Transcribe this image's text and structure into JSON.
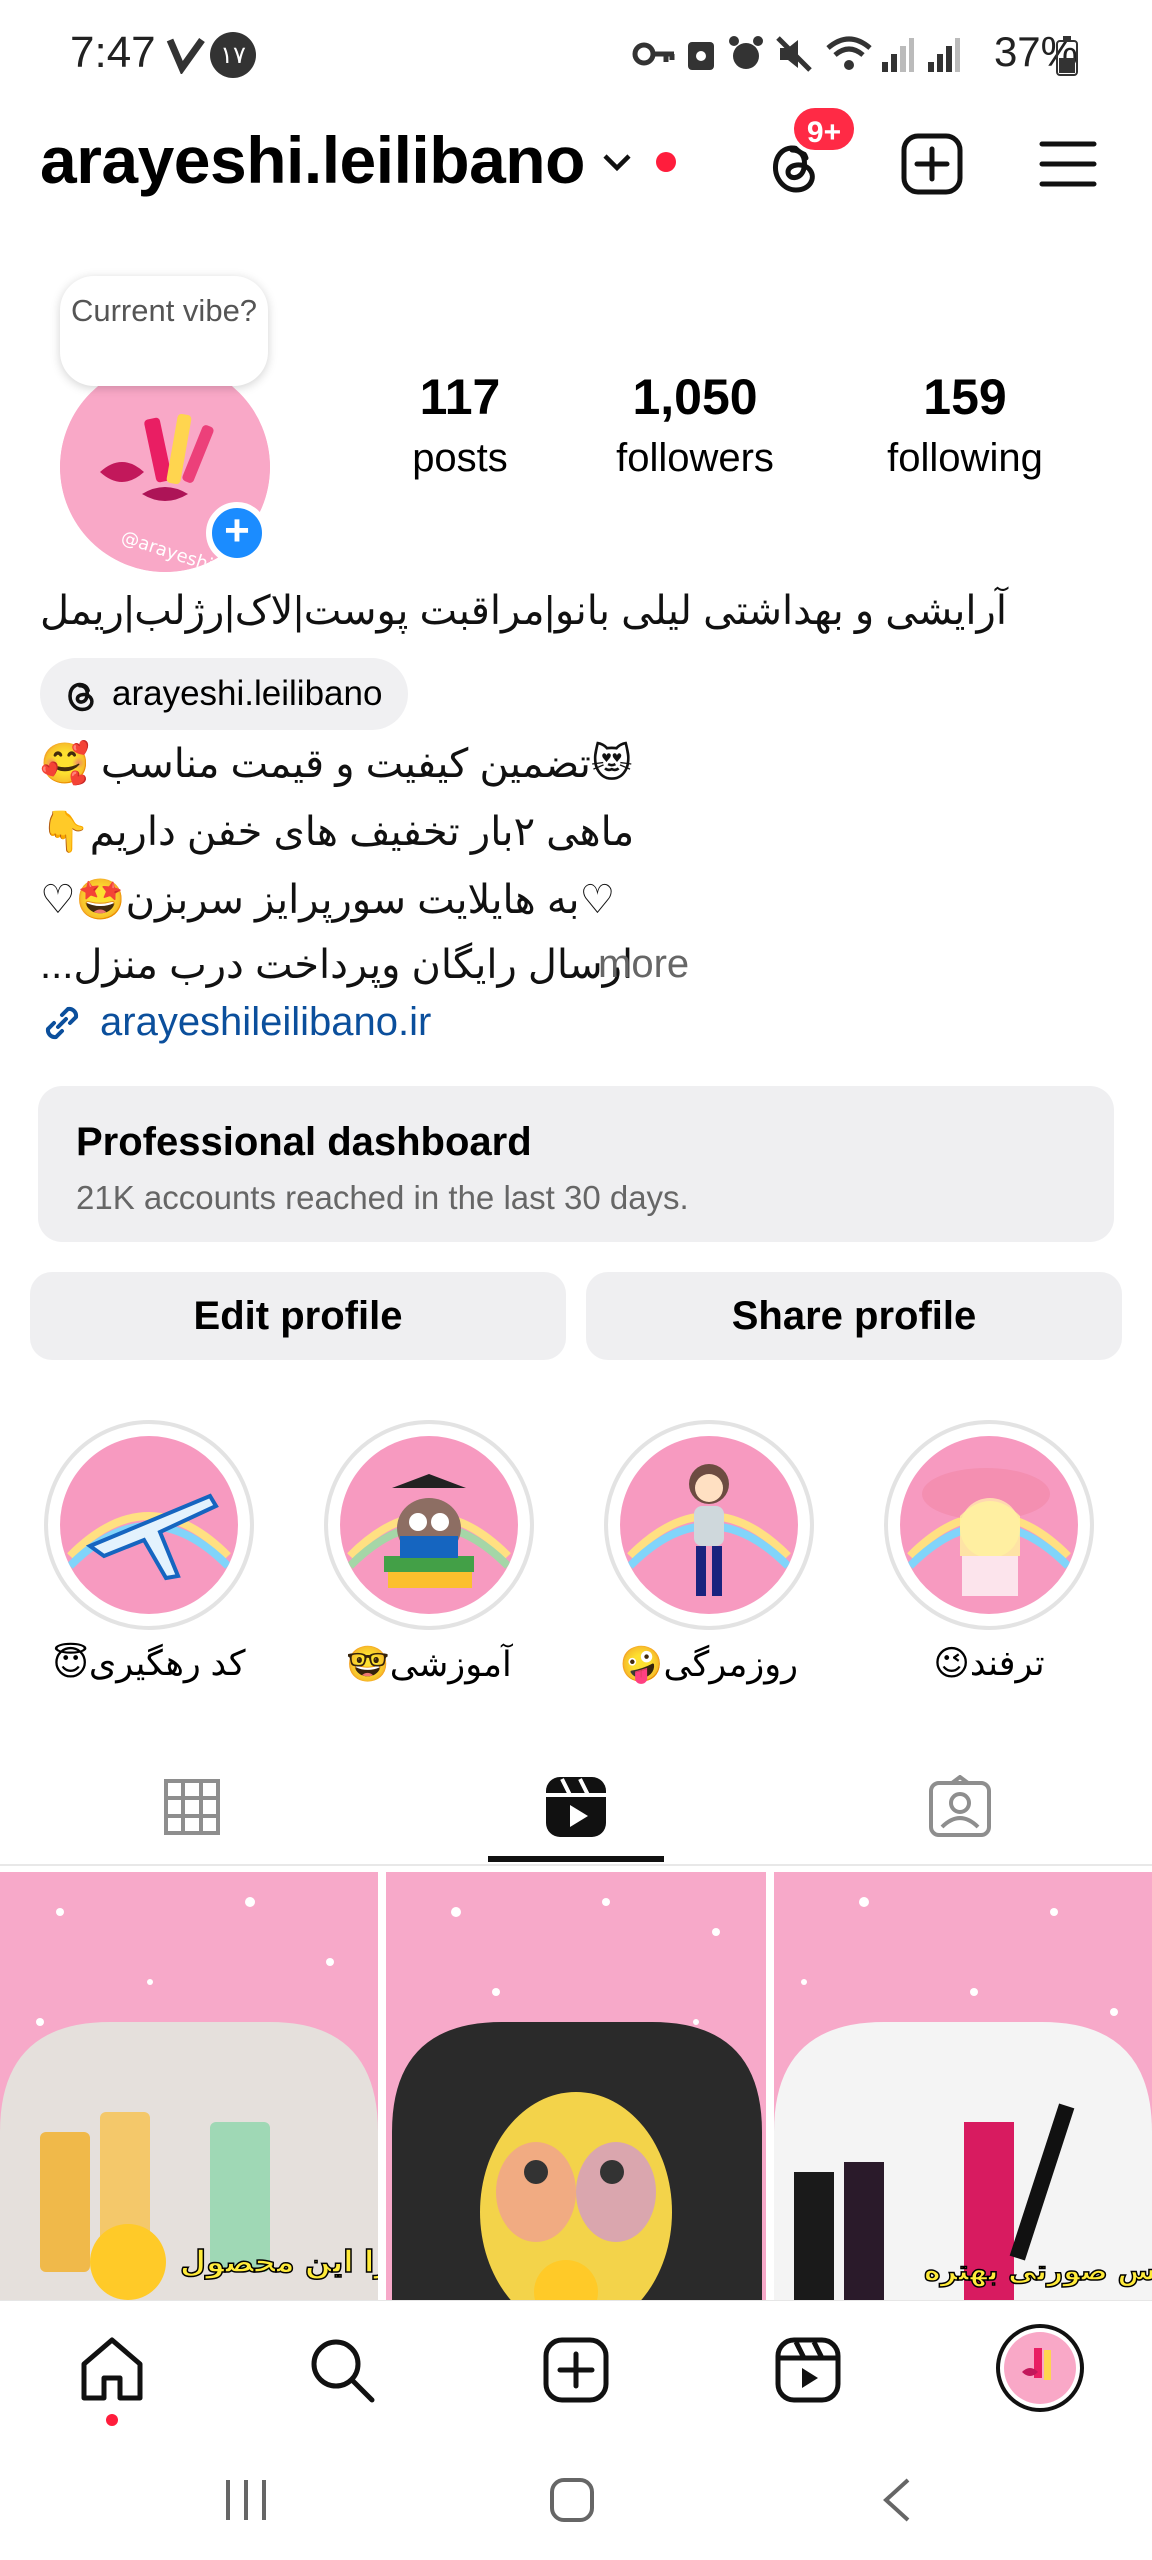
{
  "status_bar": {
    "time": "7:47",
    "battery": "37%",
    "notif_badge": "۱۷"
  },
  "header": {
    "username": "arayeshi.leilibano",
    "threads_badge": "9+"
  },
  "profile": {
    "vibe": "Current vibe?",
    "stats": [
      {
        "value": "117",
        "label": "posts"
      },
      {
        "value": "1,050",
        "label": "followers"
      },
      {
        "value": "159",
        "label": "following"
      }
    ],
    "bio_name": "آرایشی و بهداشتی لیلی بانو|مراقبت پوست|لاک|رژلب|ریمل",
    "threads_handle": "arayeshi.leilibano",
    "bio_lines": [
      "😻تضمین کیفیت و قیمت مناسب 🥰",
      "ماهی ۲بار تخفیف های خفن داریم👇",
      "♡به هایلایت سورپرایز سربزن🤩♡",
      "ارسال رایگان وپرداخت درب منزل..."
    ],
    "more": "more",
    "link": "arayeshileilibano.ir"
  },
  "dashboard": {
    "title": "Professional dashboard",
    "subtitle": "21K accounts reached in the last 30 days."
  },
  "buttons": {
    "edit": "Edit profile",
    "share": "Share profile"
  },
  "highlights": [
    {
      "label": "کد رهگیری😇"
    },
    {
      "label": "آموزشی🤓"
    },
    {
      "label": "روزمرگی🤪"
    },
    {
      "label": "ترفند😉"
    }
  ],
  "reels": [
    {
      "caption": "چرا این محصول"
    },
    {
      "caption": ""
    },
    {
      "caption": "اسنس صورتی بهتره"
    }
  ],
  "colors": {
    "accent_blue": "#1b8cff",
    "badge_red": "#ff2a45",
    "highlight_pink": "#f79ac0"
  }
}
